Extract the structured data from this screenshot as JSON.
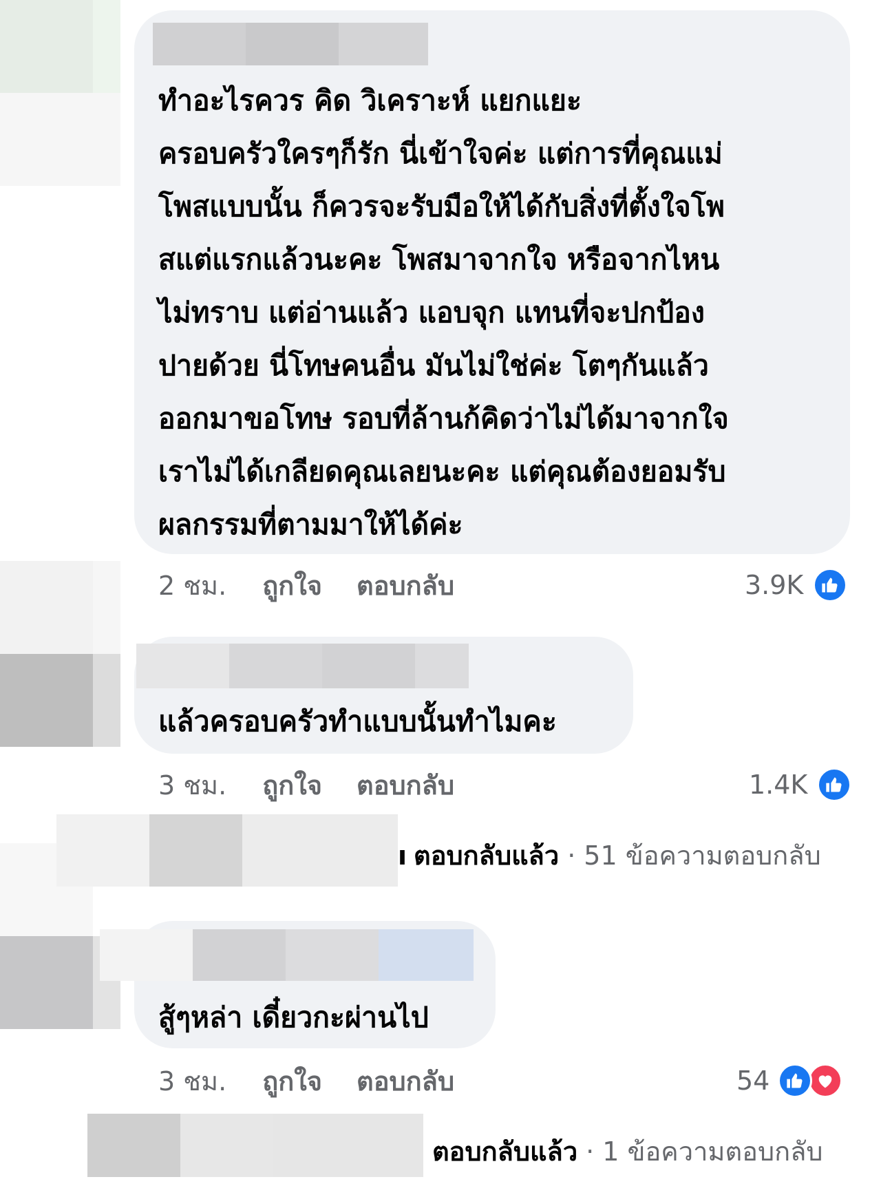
{
  "comments": [
    {
      "text": "ทำอะไรควร คิด วิเคราะห์ แยกแยะ\nครอบครัวใครๆก็รัก  นี่เข้าใจค่ะ  แต่การที่คุณแม่\nโพสแบบนั้น  ก็ควรจะรับมือให้ได้กับสิ่งที่ตั้งใจโพ\nสแต่แรกแล้วนะคะ  โพสมาจากใจ หรือจากไหน\nไม่ทราบ แต่อ่านแล้ว แอบจุก  แทนที่จะปกป้อง\nปายด้วย นี่โทษคนอื่น  มันไม่ใช่ค่ะ  โตๆกันแล้ว\nออกมาขอโทษ รอบที่ล้านก้คิดว่าไม่ได้มาจากใจ\nเราไม่ได้เกลียดคุณเลยนะคะ  แต่คุณต้องยอมรับ\nผลกรรมที่ตามมาให้ได้ค่ะ",
      "time": "2 ชม.",
      "like_label": "ถูกใจ",
      "reply_label": "ตอบกลับ",
      "reaction_count": "3.9K",
      "reactions": [
        "like-icon"
      ]
    },
    {
      "text": "แล้วครอบครัวทำแบบนั้นทำไมคะ",
      "time": "3 ชม.",
      "like_label": "ถูกใจ",
      "reply_label": "ตอบกลับ",
      "reaction_count": "1.4K",
      "reactions": [
        "like-icon"
      ],
      "replies": {
        "partial_char": "ı",
        "replied_label": "ตอบกลับแล้ว",
        "separator": "·",
        "count_label": "51 ข้อความตอบกลับ"
      }
    },
    {
      "text": "สู้ๆหล่า เดี๋ยวกะผ่านไป",
      "time": "3 ชม.",
      "like_label": "ถูกใจ",
      "reply_label": "ตอบกลับ",
      "reaction_count": "54",
      "reactions": [
        "like-icon",
        "love-icon"
      ],
      "replies": {
        "replied_label": "ตอบกลับแล้ว",
        "separator": "·",
        "count_label": "1 ข้อความตอบกลับ"
      }
    }
  ],
  "colors": {
    "bubble": "#f0f2f5",
    "meta_text": "#65676b",
    "like_blue": "#1877f2",
    "love_red": "#f33e58"
  }
}
